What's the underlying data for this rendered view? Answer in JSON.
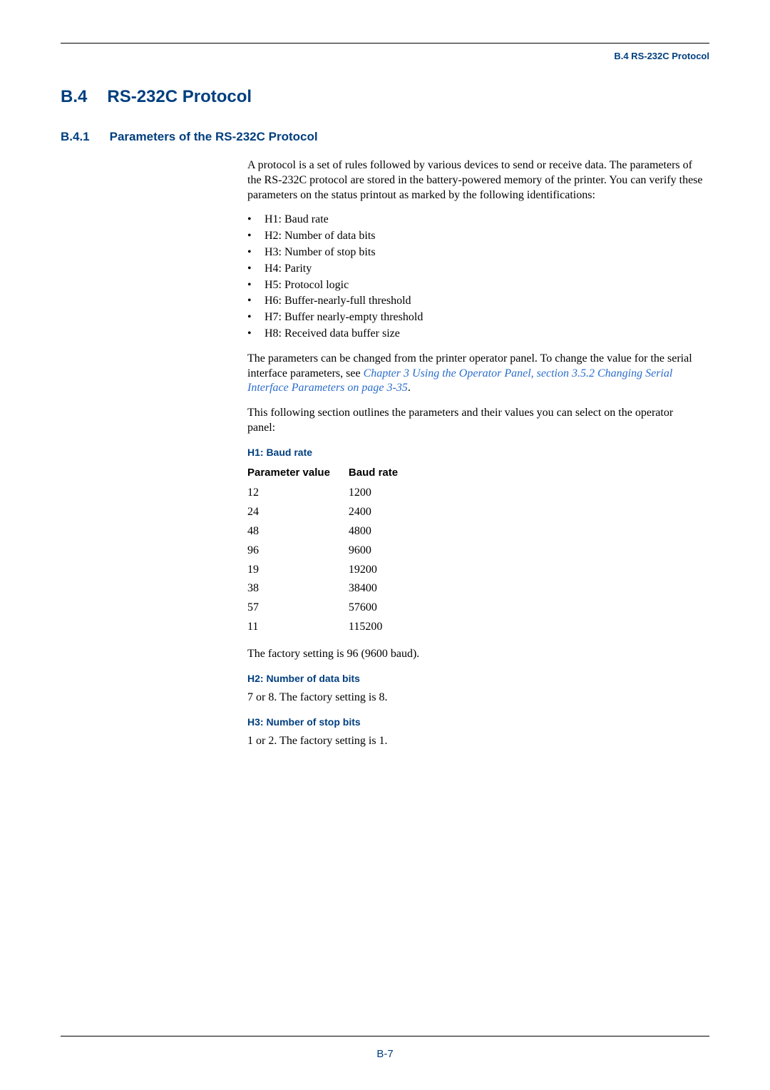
{
  "header": {
    "running_head": "B.4 RS-232C Protocol"
  },
  "section": {
    "number": "B.4",
    "title": "RS-232C Protocol"
  },
  "subsection": {
    "number": "B.4.1",
    "title": "Parameters of the RS-232C Protocol"
  },
  "intro_para": "A protocol is a set of rules followed by various devices to send or receive data. The parameters of the RS-232C protocol are stored in the battery-powered memory of the printer. You can verify these parameters on the status printout as marked by the following identifications:",
  "bullets": [
    "H1: Baud rate",
    "H2: Number of data bits",
    "H3: Number of stop bits",
    "H4: Parity",
    "H5: Protocol logic",
    "H6: Buffer-nearly-full threshold",
    "H7: Buffer nearly-empty threshold",
    "H8: Received data buffer size"
  ],
  "change_para_lead": "The parameters can be changed from the printer operator panel. To change the value for the serial interface parameters, see ",
  "change_para_link": "Chapter 3 Using the Operator Panel, section 3.5.2 Changing Serial Interface Parameters on page 3-35",
  "change_para_tail": ".",
  "outline_para": "This following section outlines the parameters and their values you can select on the operator panel:",
  "h1": {
    "heading": "H1: Baud rate",
    "col_param": "Parameter value",
    "col_baud": "Baud rate",
    "rows": [
      {
        "param": "12",
        "baud": "1200"
      },
      {
        "param": "24",
        "baud": "2400"
      },
      {
        "param": "48",
        "baud": "4800"
      },
      {
        "param": "96",
        "baud": "9600"
      },
      {
        "param": "19",
        "baud": "19200"
      },
      {
        "param": "38",
        "baud": "38400"
      },
      {
        "param": "57",
        "baud": "57600"
      },
      {
        "param": "11",
        "baud": "115200"
      }
    ],
    "factory": "The factory setting is 96 (9600 baud)."
  },
  "h2": {
    "heading": "H2: Number of data bits",
    "text": "7 or 8. The factory setting is 8."
  },
  "h3": {
    "heading": "H3: Number of stop bits",
    "text": "1 or 2. The factory setting is 1."
  },
  "footer": {
    "page_number": "B-7"
  }
}
